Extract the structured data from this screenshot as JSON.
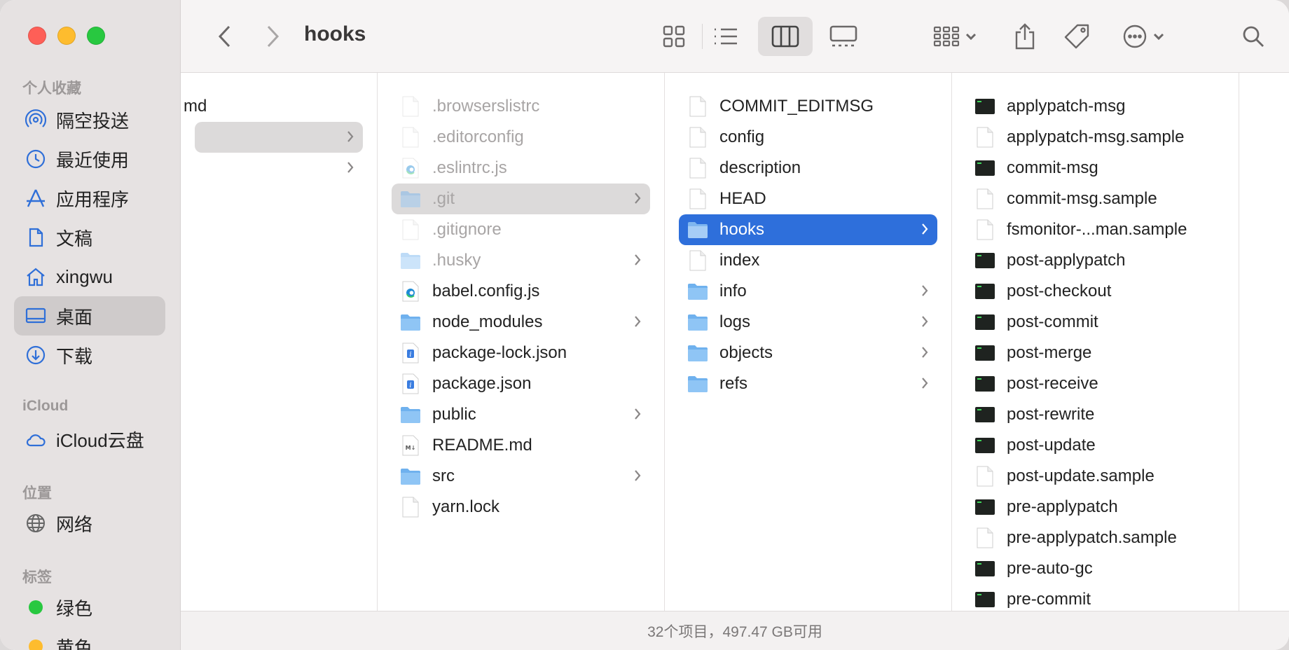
{
  "window": {
    "title": "hooks"
  },
  "sidebar": {
    "favorites_header": "个人收藏",
    "favorites": [
      {
        "label": "隔空投送",
        "icon": "airdrop-icon"
      },
      {
        "label": "最近使用",
        "icon": "clock-icon"
      },
      {
        "label": "应用程序",
        "icon": "applications-icon"
      },
      {
        "label": "文稿",
        "icon": "document-icon"
      },
      {
        "label": "xingwu",
        "icon": "home-icon"
      },
      {
        "label": "桌面",
        "icon": "desktop-icon",
        "selected": true
      },
      {
        "label": "下载",
        "icon": "download-icon"
      }
    ],
    "icloud_header": "iCloud",
    "icloud": [
      {
        "label": "iCloud云盘",
        "icon": "cloud-icon"
      }
    ],
    "locations_header": "位置",
    "locations": [
      {
        "label": "网络",
        "icon": "network-icon"
      }
    ],
    "tags_header": "标签",
    "tags": [
      {
        "label": "绿色",
        "color": "#28c840"
      },
      {
        "label": "黄色",
        "color": "#febc2e"
      }
    ]
  },
  "columns": {
    "col1": [
      {
        "name": "md",
        "type": "partial"
      },
      {
        "name": "",
        "type": "folder",
        "selected": "grey",
        "chevron": true
      },
      {
        "name": "",
        "type": "folder",
        "chevron": true
      }
    ],
    "col2": [
      {
        "name": ".browserslistrc",
        "type": "file",
        "dim": true
      },
      {
        "name": ".editorconfig",
        "type": "file",
        "dim": true
      },
      {
        "name": ".eslintrc.js",
        "type": "edge",
        "dim": true
      },
      {
        "name": ".git",
        "type": "folder",
        "dim": true,
        "selected": "grey",
        "chevron": true
      },
      {
        "name": ".gitignore",
        "type": "file",
        "dim": true
      },
      {
        "name": ".husky",
        "type": "folder",
        "dim": true,
        "chevron": true
      },
      {
        "name": "babel.config.js",
        "type": "edge"
      },
      {
        "name": "node_modules",
        "type": "folder",
        "chevron": true
      },
      {
        "name": "package-lock.json",
        "type": "json"
      },
      {
        "name": "package.json",
        "type": "json"
      },
      {
        "name": "public",
        "type": "folder",
        "chevron": true
      },
      {
        "name": "README.md",
        "type": "markdown"
      },
      {
        "name": "src",
        "type": "folder",
        "chevron": true
      },
      {
        "name": "yarn.lock",
        "type": "file"
      }
    ],
    "col3": [
      {
        "name": "COMMIT_EDITMSG",
        "type": "file"
      },
      {
        "name": "config",
        "type": "file"
      },
      {
        "name": "description",
        "type": "file"
      },
      {
        "name": "HEAD",
        "type": "file"
      },
      {
        "name": "hooks",
        "type": "folder",
        "selected": "blue",
        "chevron": true
      },
      {
        "name": "index",
        "type": "file"
      },
      {
        "name": "info",
        "type": "folder",
        "chevron": true
      },
      {
        "name": "logs",
        "type": "folder",
        "chevron": true
      },
      {
        "name": "objects",
        "type": "folder",
        "chevron": true
      },
      {
        "name": "refs",
        "type": "folder",
        "chevron": true
      }
    ],
    "col4": [
      {
        "name": "applypatch-msg",
        "type": "exec"
      },
      {
        "name": "applypatch-msg.sample",
        "type": "file"
      },
      {
        "name": "commit-msg",
        "type": "exec"
      },
      {
        "name": "commit-msg.sample",
        "type": "file"
      },
      {
        "name": "fsmonitor-...man.sample",
        "type": "file"
      },
      {
        "name": "post-applypatch",
        "type": "exec"
      },
      {
        "name": "post-checkout",
        "type": "exec"
      },
      {
        "name": "post-commit",
        "type": "exec"
      },
      {
        "name": "post-merge",
        "type": "exec"
      },
      {
        "name": "post-receive",
        "type": "exec"
      },
      {
        "name": "post-rewrite",
        "type": "exec"
      },
      {
        "name": "post-update",
        "type": "exec"
      },
      {
        "name": "post-update.sample",
        "type": "file"
      },
      {
        "name": "pre-applypatch",
        "type": "exec"
      },
      {
        "name": "pre-applypatch.sample",
        "type": "file"
      },
      {
        "name": "pre-auto-gc",
        "type": "exec"
      },
      {
        "name": "pre-commit",
        "type": "exec"
      }
    ]
  },
  "status_bar": {
    "text": "32个项目，497.47 GB可用"
  }
}
